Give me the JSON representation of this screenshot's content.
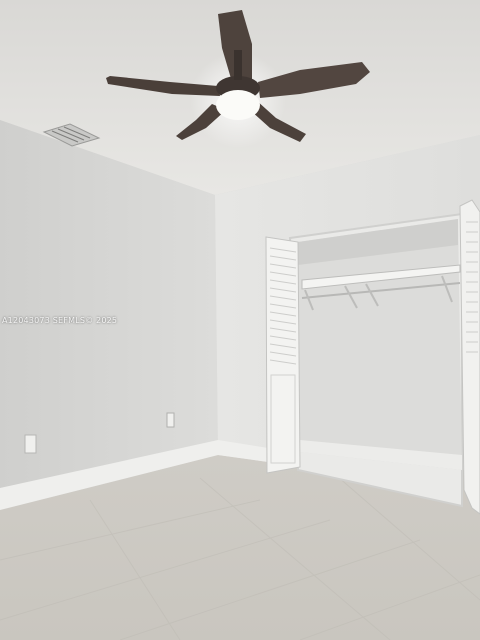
{
  "photo": {
    "watermark_text": "A12043073 SEFMLS© 2025"
  },
  "colors": {
    "ceiling": "#e2e1de",
    "wall_left": "#d6d6d4",
    "wall_back": "#e4e4e2",
    "closet_interior": "#dcdcda",
    "floor": "#cfccc6",
    "fan_blade": "#4e433d",
    "fan_light": "#fbfbf8",
    "baseboard": "#efefed",
    "door": "#f3f3f1"
  }
}
